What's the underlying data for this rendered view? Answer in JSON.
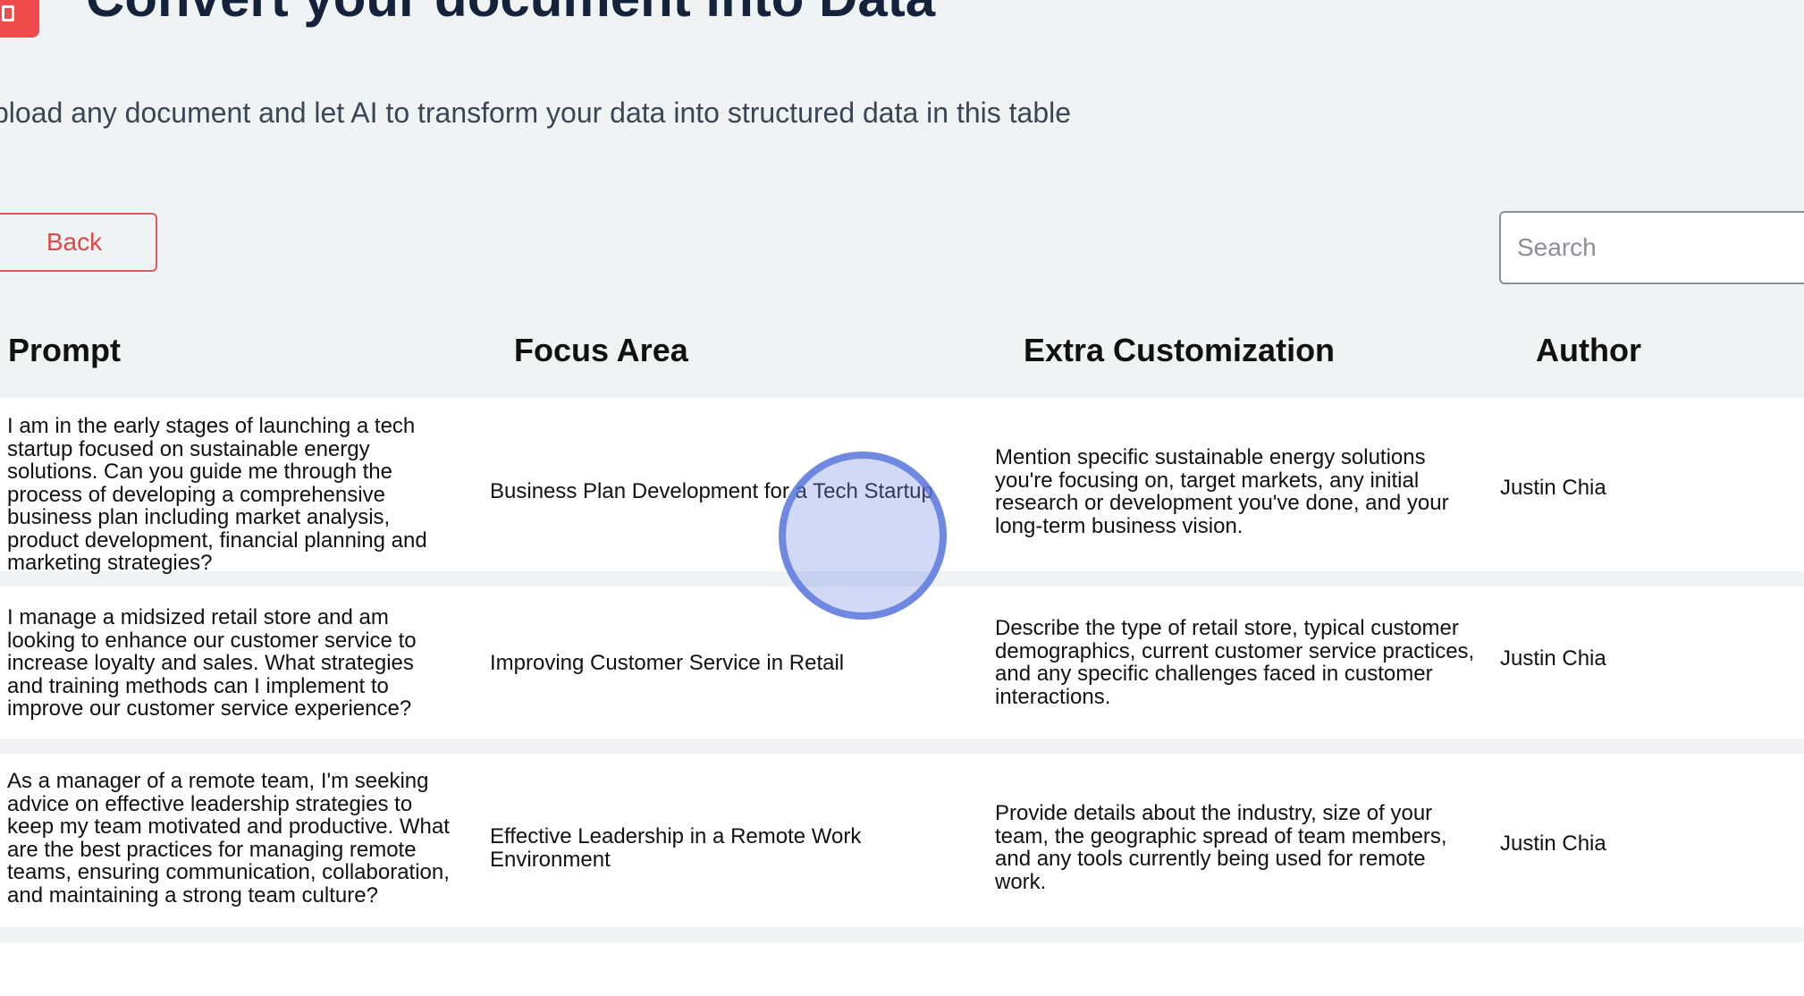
{
  "header": {
    "title": "Convert your document into Data",
    "subtitle": "pload any document and let AI to transform your data into structured data in this table"
  },
  "toolbar": {
    "back_label": "Back",
    "search_placeholder": "Search",
    "search_value": ""
  },
  "table": {
    "columns": [
      "Prompt",
      "Focus Area",
      "Extra Customization",
      "Author"
    ],
    "rows": [
      {
        "prompt": "I am in the early stages of launching a tech startup focused on sustainable energy solutions. Can you guide me through the process of developing a comprehensive business plan including market analysis, product development, financial planning and marketing strategies?",
        "focus_area": "Business Plan Development for a Tech Startup",
        "extra": "Mention specific sustainable energy solutions you're focusing on, target markets, any initial research or development you've done, and your long-term business vision.",
        "author": "Justin Chia"
      },
      {
        "prompt": "I manage a midsized retail store and am looking to enhance our customer service to increase loyalty and sales. What strategies and training methods can I implement to improve our customer service experience?",
        "focus_area": "Improving Customer Service in Retail",
        "extra": "Describe the type of retail store, typical customer demographics, current customer service practices, and any specific challenges faced in customer interactions.",
        "author": "Justin Chia"
      },
      {
        "prompt": "As a manager of a remote team, I'm seeking advice on effective leadership strategies to keep my team motivated and productive. What are the best practices for managing remote teams, ensuring communication, collaboration, and maintaining a strong team culture?",
        "focus_area": "Effective Leadership in a Remote Work Environment",
        "extra": "Provide details about the industry, size of your team, the geographic spread of team members, and any tools currently being used for remote work.",
        "author": "Justin Chia"
      }
    ]
  },
  "colors": {
    "background": "#eff3f3",
    "accent": "#ef4b4b",
    "title": "#14233b",
    "touch_indicator": "#5876de"
  },
  "icons": {
    "logo": "document-icon"
  }
}
